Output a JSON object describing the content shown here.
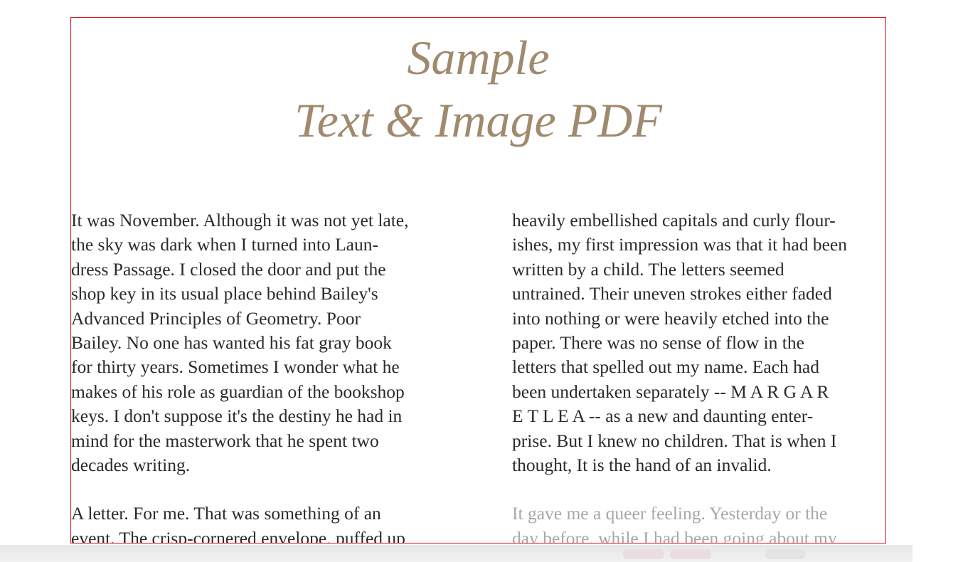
{
  "document": {
    "title_line1": "Sample",
    "title_line2": "Text & Image PDF",
    "left_column": {
      "paragraph1": [
        "It was November. Although it was not yet late,",
        "the sky was dark when I turned into Laun-",
        "dress Passage. I closed the door and put the",
        "shop key in its usual place behind Bailey's",
        "Advanced Principles of Geometry. Poor",
        "Bailey. No one has wanted his fat gray book",
        "for thirty years. Sometimes I wonder what he",
        "makes of his role as guardian of the bookshop",
        "keys. I don't suppose it's the destiny he had in",
        "mind for the masterwork that he spent two",
        "decades writing."
      ],
      "paragraph2": [
        "A letter. For me. That was something of an",
        "event. The crisp-cornered envelope, puffed up"
      ]
    },
    "right_column": {
      "paragraph1": [
        "heavily embellished capitals and curly flour-",
        "ishes, my first impression was that it had been",
        "written by a child. The letters seemed",
        "untrained. Their uneven strokes either faded",
        "into nothing or were heavily etched into the",
        "paper. There was no sense of flow in the",
        "letters that spelled out my name. Each had",
        "been undertaken separately -- M A R G A R",
        "E T L E A -- as a new and daunting enter-",
        "prise. But I knew no children. That is when I",
        "thought, It is the hand of an invalid."
      ],
      "paragraph2": [
        "It gave me a queer feeling. Yesterday or the",
        "day before, while I had been going about my"
      ]
    },
    "colors": {
      "title": "#a08a6e",
      "body_text": "#2a2a2a",
      "faded_text": "#a7a7a7",
      "page_border": "#e0141e"
    }
  }
}
